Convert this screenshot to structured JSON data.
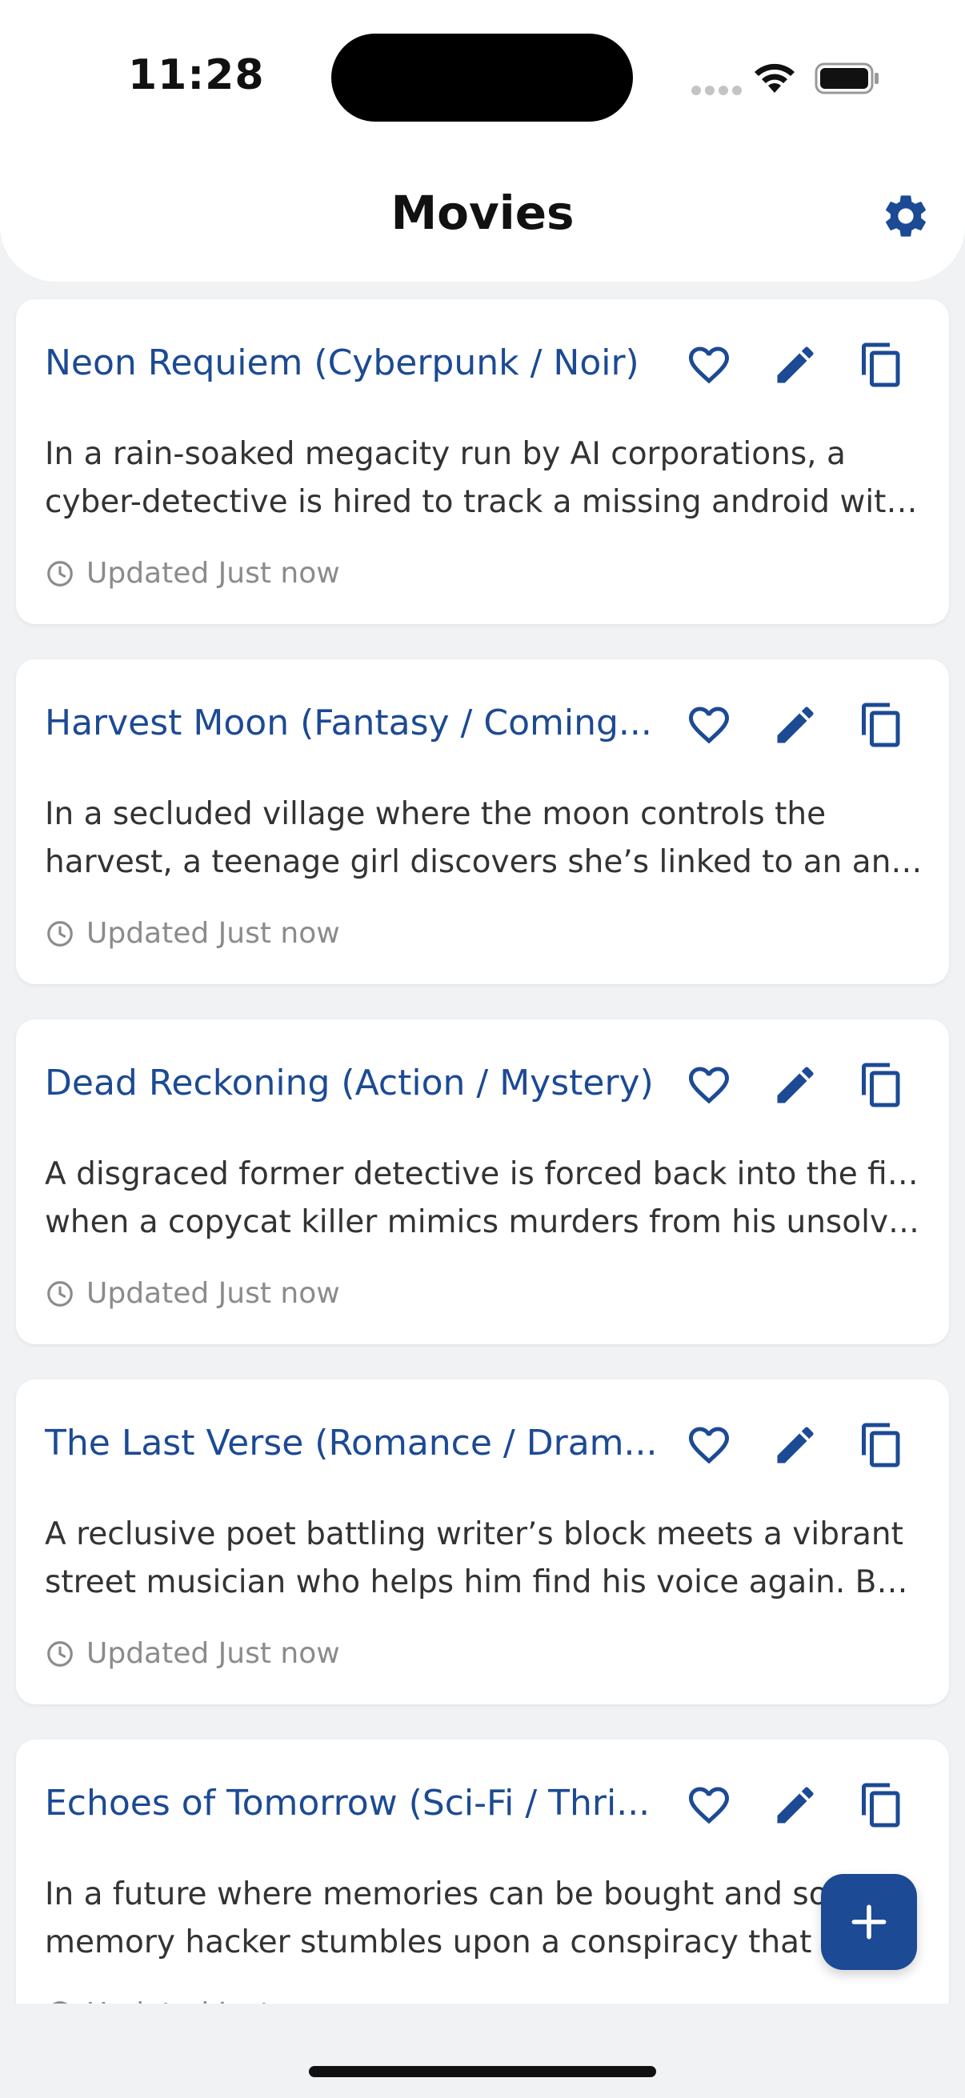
{
  "status_bar": {
    "time": "11:28"
  },
  "header": {
    "title": "Movies",
    "settings_icon": "gear-icon"
  },
  "colors": {
    "accent": "#1c4a94",
    "background": "#f1f2f4",
    "card": "#ffffff"
  },
  "movies": [
    {
      "title": "Neon Requiem (Cyberpunk / Noir)",
      "desc_line1": "In a rain-soaked megacity run by AI corporations, a",
      "desc_line2": "cyber-detective is hired to track a missing android with ...",
      "updated": "Updated Just now"
    },
    {
      "title": "Harvest Moon (Fantasy / Coming...",
      "desc_line1": "In a secluded village where the moon controls the",
      "desc_line2": "harvest, a teenage girl discovers she’s linked to an ancie...",
      "updated": "Updated Just now"
    },
    {
      "title": "Dead Reckoning (Action / Mystery)",
      "desc_line1": "A disgraced former detective is forced back into the field",
      "desc_line2": "when a copycat killer mimics murders from his unsolved ...",
      "updated": "Updated Just now"
    },
    {
      "title": "The Last Verse (Romance / Dram...",
      "desc_line1": "A reclusive poet battling writer’s block meets a vibrant",
      "desc_line2": "street musician who helps him find his voice again. But a...",
      "updated": "Updated Just now"
    },
    {
      "title": "Echoes of Tomorrow (Sci-Fi / Thri...",
      "desc_line1": "In a future where memories can be bought and sold, a",
      "desc_line2": "memory hacker stumbles upon a conspiracy that co...",
      "updated": "Updated Just now"
    }
  ],
  "fab": {
    "icon": "plus-icon"
  }
}
